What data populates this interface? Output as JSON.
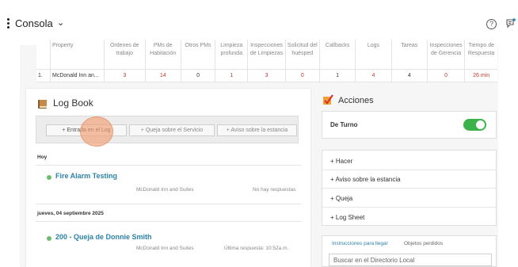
{
  "topbar": {
    "title": "Consola"
  },
  "stats": {
    "headers": [
      "",
      "Property",
      "Ordenes de trabajo",
      "PMs de Habitación",
      "Otros PMs",
      "Limpieza profunda",
      "Inspecciones de Limpiezas",
      "Solicitud del huésped",
      "Callbacks",
      "Logs",
      "Tareas",
      "Inspecciones de Gerencia",
      "Tiempo de Respuesta"
    ],
    "row": [
      "1.",
      "McDonald Inn an...",
      "3",
      "14",
      "0",
      "1",
      "3",
      "0",
      "1",
      "4",
      "4",
      "0",
      "26 min"
    ]
  },
  "logbook": {
    "title": "Log Book",
    "buttons": {
      "entry": "+ Entrada en el Log",
      "complaint": "+ Queja sobre el Servicio",
      "notice": "+ Aviso sobre la estancia"
    },
    "today_label": "Hoy",
    "entry1": {
      "title": "Fire Alarm Testing",
      "property": "McDonald Inn and Suites",
      "status": "No hay respuestas"
    },
    "date_label": "jueves, 04 septiembre 2025",
    "entry2": {
      "title": "200 - Queja de Donnie Smith",
      "property": "McDonald Inn and Suites",
      "status": "Última respuesta: 10:52a.m."
    }
  },
  "acciones": {
    "title": "Acciones",
    "duty_label": "De Turno",
    "duty_on": true,
    "items": [
      "+ Hacer",
      "+ Aviso sobre la estancia",
      "+ Queja",
      "+ Log Sheet"
    ],
    "tabs": [
      "Instrucciones para llegar",
      "Objetos perdidos"
    ],
    "search_value": "Buscar en el Directorio Local"
  },
  "colors": {
    "accent": "#2c82a8",
    "red": "#c0392b",
    "toggle": "#3cb34a",
    "dot": "#6bbf6b",
    "ripple": "#f09b6e"
  }
}
